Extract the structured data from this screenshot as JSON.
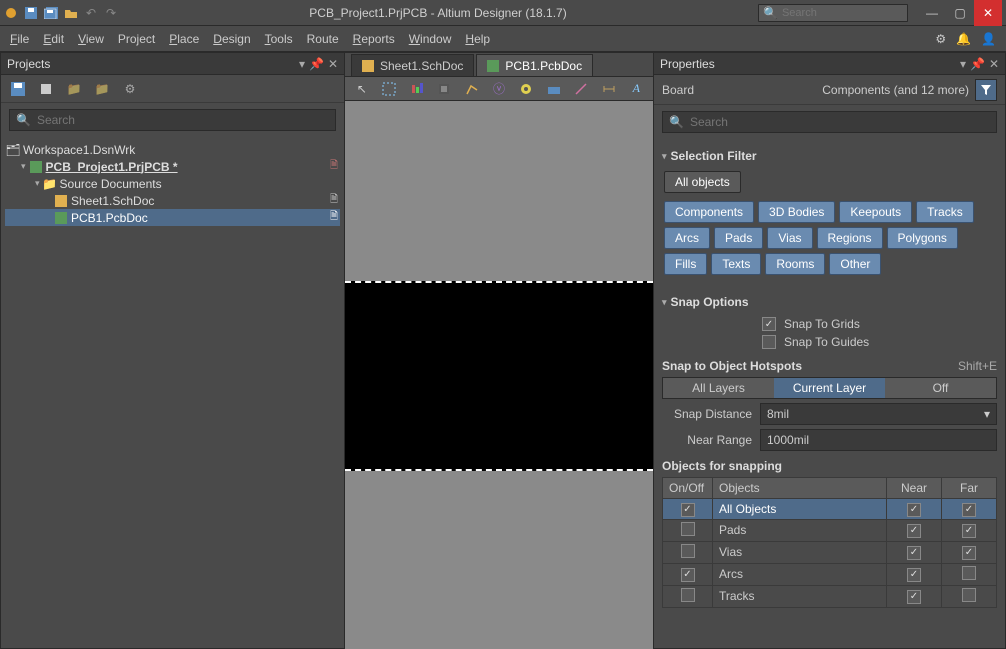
{
  "titlebar": {
    "title": "PCB_Project1.PrjPCB - Altium Designer (18.1.7)",
    "search_placeholder": "Search"
  },
  "menubar": [
    "File",
    "Edit",
    "View",
    "Project",
    "Place",
    "Design",
    "Tools",
    "Route",
    "Reports",
    "Window",
    "Help"
  ],
  "projects_panel": {
    "title": "Projects",
    "search_placeholder": "Search",
    "tree": {
      "workspace": "Workspace1.DsnWrk",
      "project": "PCB_Project1.PrjPCB *",
      "folder": "Source Documents",
      "docs": [
        {
          "name": "Sheet1.SchDoc",
          "selected": false
        },
        {
          "name": "PCB1.PcbDoc",
          "selected": true
        }
      ]
    }
  },
  "tabs": [
    {
      "label": "Sheet1.SchDoc",
      "active": false
    },
    {
      "label": "PCB1.PcbDoc",
      "active": true
    }
  ],
  "properties": {
    "title": "Properties",
    "context_left": "Board",
    "context_right": "Components (and 12 more)",
    "search_placeholder": "Search",
    "selection_filter": {
      "title": "Selection Filter",
      "all": "All objects",
      "chips": [
        "Components",
        "3D Bodies",
        "Keepouts",
        "Tracks",
        "Arcs",
        "Pads",
        "Vias",
        "Regions",
        "Polygons",
        "Fills",
        "Texts",
        "Rooms",
        "Other"
      ]
    },
    "snap_options": {
      "title": "Snap Options",
      "snap_grids": {
        "label": "Snap To Grids",
        "checked": true
      },
      "snap_guides": {
        "label": "Snap To Guides",
        "checked": false
      }
    },
    "hotspots": {
      "title": "Snap to Object Hotspots",
      "shortcut": "Shift+E",
      "layers": [
        "All Layers",
        "Current Layer",
        "Off"
      ],
      "active_layer_idx": 1,
      "snap_distance_label": "Snap Distance",
      "snap_distance": "8mil",
      "near_range_label": "Near Range",
      "near_range": "1000mil"
    },
    "snapping": {
      "title": "Objects for snapping",
      "cols": [
        "On/Off",
        "Objects",
        "Near",
        "Far"
      ],
      "rows": [
        {
          "on": true,
          "name": "All Objects",
          "near": true,
          "far": true,
          "sel": true
        },
        {
          "on": false,
          "name": "Pads",
          "near": true,
          "far": true,
          "sel": false
        },
        {
          "on": false,
          "name": "Vias",
          "near": true,
          "far": true,
          "sel": false
        },
        {
          "on": true,
          "name": "Arcs",
          "near": true,
          "far": false,
          "sel": false
        },
        {
          "on": false,
          "name": "Tracks",
          "near": true,
          "far": false,
          "sel": false
        }
      ]
    }
  }
}
